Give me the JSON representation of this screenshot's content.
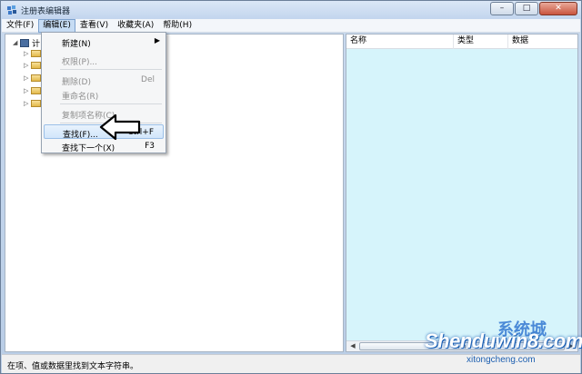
{
  "window": {
    "title": "注册表编辑器",
    "buttons": {
      "minimize": "–",
      "maximize": "□",
      "close": "✕"
    }
  },
  "menubar": {
    "items": [
      {
        "label": "文件(F)"
      },
      {
        "label": "编辑(E)",
        "active": true
      },
      {
        "label": "查看(V)"
      },
      {
        "label": "收藏夹(A)"
      },
      {
        "label": "帮助(H)"
      }
    ]
  },
  "edit_menu": {
    "items": [
      {
        "label": "新建(N)",
        "shortcut": "",
        "submenu": true,
        "enabled": true
      },
      {
        "label": "权限(P)...",
        "shortcut": "",
        "enabled": false
      },
      {
        "label": "删除(D)",
        "shortcut": "Del",
        "enabled": false
      },
      {
        "label": "重命名(R)",
        "shortcut": "",
        "enabled": false
      },
      {
        "label": "复制项名称(C)",
        "shortcut": "",
        "enabled": false
      },
      {
        "label": "查找(F)...",
        "shortcut": "Ctrl+F",
        "enabled": true,
        "hovered": true
      },
      {
        "label": "查找下一个(X)",
        "shortcut": "F3",
        "enabled": true
      }
    ]
  },
  "tree": {
    "root_label": "计",
    "child_count": 5
  },
  "list": {
    "columns": [
      {
        "label": "名称"
      },
      {
        "label": "类型"
      },
      {
        "label": "数据"
      }
    ]
  },
  "statusbar": {
    "text": "在项、值或数据里找到文本字符串。"
  },
  "watermark": {
    "main": "Shenduwin8.com",
    "sub": "xitongcheng.com",
    "logo": "系统城"
  },
  "colors": {
    "list_background": "#d6f4fb",
    "menu_active": "#c6dcf4",
    "watermark_blue": "#1a5fb4"
  }
}
